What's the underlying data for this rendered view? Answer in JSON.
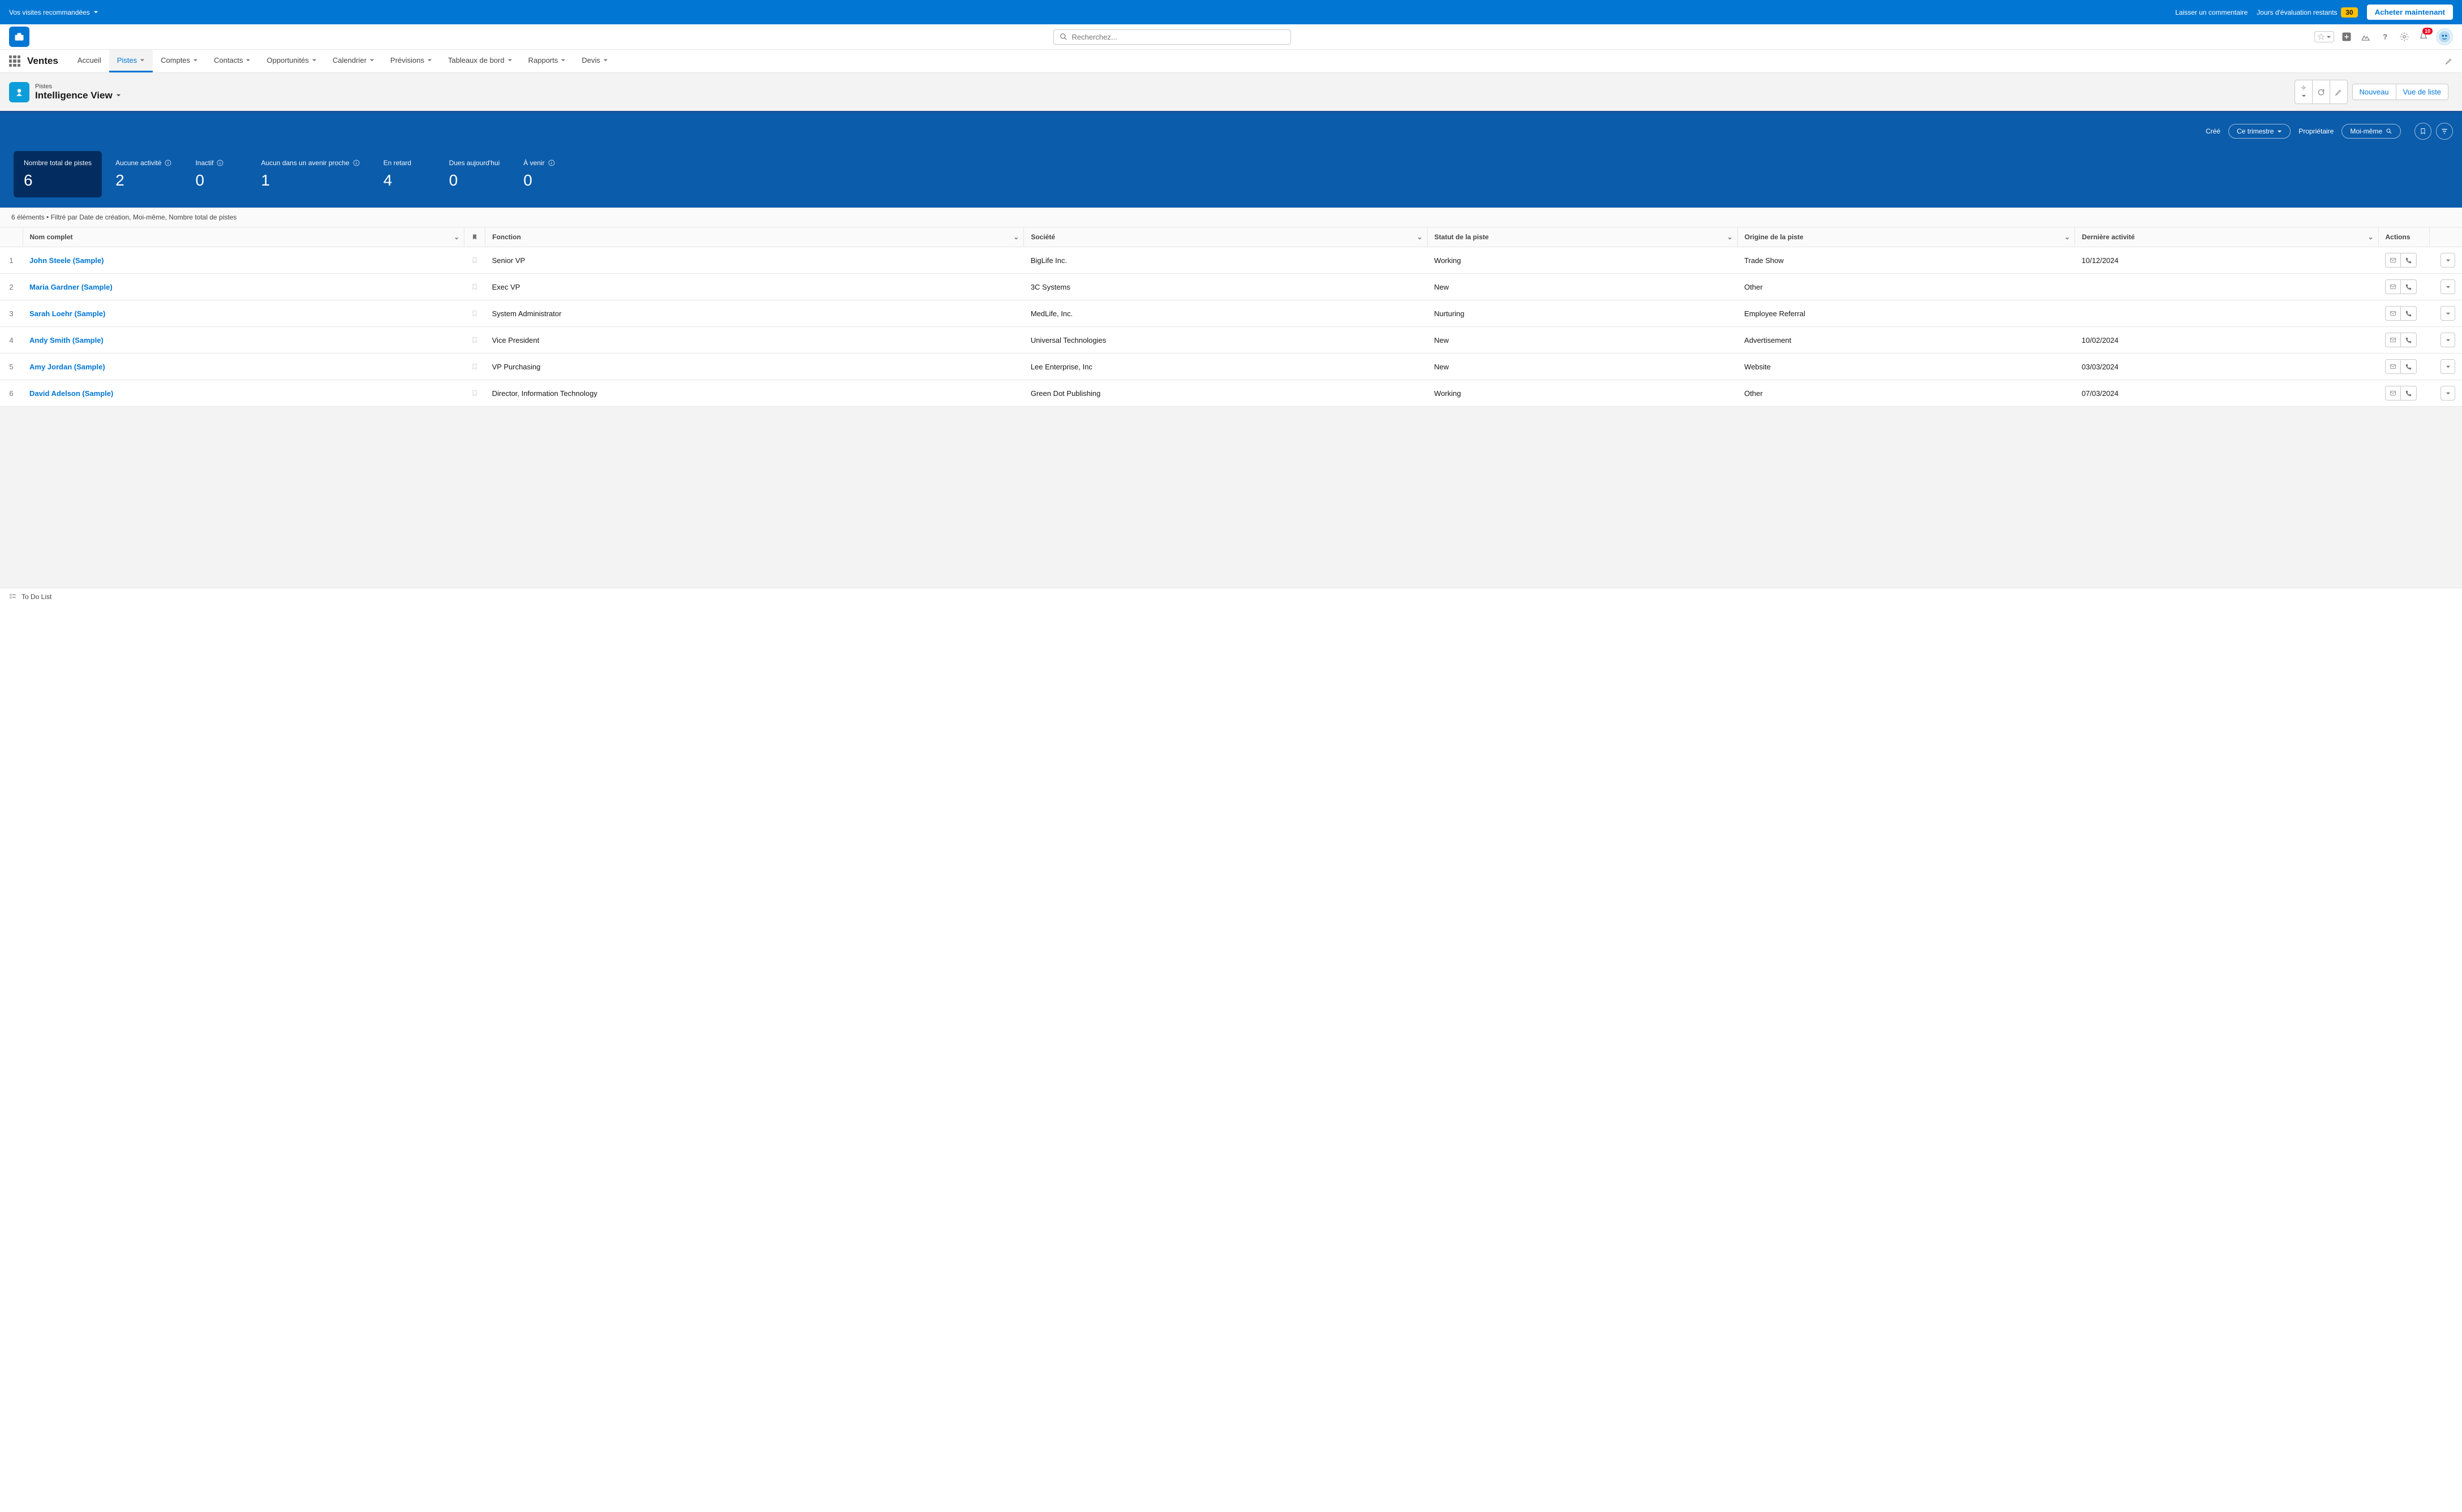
{
  "banner": {
    "left": "Vos visites recommandées",
    "comment": "Laisser un commentaire",
    "trial": "Jours d'évaluation restants",
    "days": "30",
    "buy": "Acheter maintenant"
  },
  "search": {
    "placeholder": "Recherchez..."
  },
  "notif_count": "10",
  "nav": {
    "app": "Ventes",
    "items": [
      "Accueil",
      "Pistes",
      "Comptes",
      "Contacts",
      "Opportunités",
      "Calendrier",
      "Prévisions",
      "Tableaux de bord",
      "Rapports",
      "Devis"
    ],
    "active_index": 1
  },
  "page": {
    "type": "Pistes",
    "view": "Intelligence View",
    "actions": {
      "gear": "⚙",
      "refresh": "↻",
      "edit": "✎",
      "new": "Nouveau",
      "list": "Vue de liste"
    }
  },
  "filters": {
    "created": "Créé",
    "period": "Ce trimestre",
    "owner": "Propriétaire",
    "scope": "Moi-même"
  },
  "metrics": [
    {
      "label": "Nombre total de pistes",
      "value": "6",
      "active": true,
      "info": false
    },
    {
      "label": "Aucune activité",
      "value": "2",
      "active": false,
      "info": true
    },
    {
      "label": "Inactif",
      "value": "0",
      "active": false,
      "info": true
    },
    {
      "label": "Aucun dans un avenir proche",
      "value": "1",
      "active": false,
      "info": true
    },
    {
      "label": "En retard",
      "value": "4",
      "active": false,
      "info": false
    },
    {
      "label": "Dues aujourd'hui",
      "value": "0",
      "active": false,
      "info": false
    },
    {
      "label": "À venir",
      "value": "0",
      "active": false,
      "info": true
    }
  ],
  "summary": "6 éléments • Filtré par Date de création, Moi-même, Nombre total de pistes",
  "columns": {
    "name": "Nom complet",
    "function": "Fonction",
    "company": "Société",
    "status": "Statut de la piste",
    "origin": "Origine de la piste",
    "activity": "Dernière activité",
    "actions": "Actions"
  },
  "rows": [
    {
      "n": "1",
      "name": "John Steele (Sample)",
      "func": "Senior VP",
      "company": "BigLife Inc.",
      "status": "Working",
      "origin": "Trade Show",
      "activity": "10/12/2024"
    },
    {
      "n": "2",
      "name": "Maria Gardner (Sample)",
      "func": "Exec VP",
      "company": "3C Systems",
      "status": "New",
      "origin": "Other",
      "activity": ""
    },
    {
      "n": "3",
      "name": "Sarah Loehr (Sample)",
      "func": "System Administrator",
      "company": "MedLife, Inc.",
      "status": "Nurturing",
      "origin": "Employee Referral",
      "activity": ""
    },
    {
      "n": "4",
      "name": "Andy Smith (Sample)",
      "func": "Vice President",
      "company": "Universal Technologies",
      "status": "New",
      "origin": "Advertisement",
      "activity": "10/02/2024"
    },
    {
      "n": "5",
      "name": "Amy Jordan (Sample)",
      "func": "VP Purchasing",
      "company": "Lee Enterprise, Inc",
      "status": "New",
      "origin": "Website",
      "activity": "03/03/2024"
    },
    {
      "n": "6",
      "name": "David Adelson (Sample)",
      "func": "Director, Information Technology",
      "company": "Green Dot Publishing",
      "status": "Working",
      "origin": "Other",
      "activity": "07/03/2024"
    }
  ],
  "footer": {
    "todo": "To Do List"
  }
}
